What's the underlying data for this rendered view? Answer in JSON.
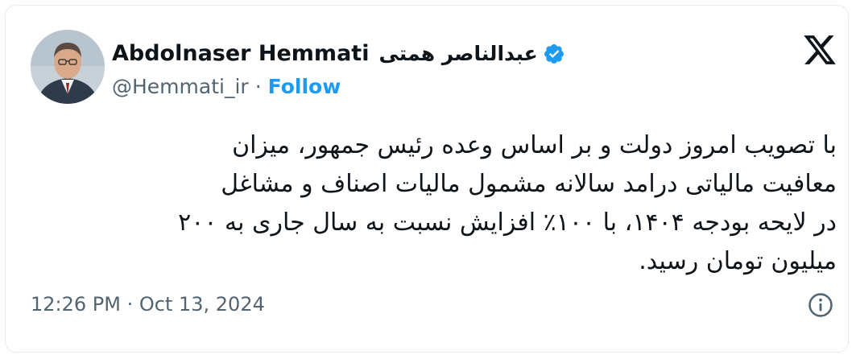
{
  "tweet": {
    "author_name": "Abdolnaser Hemmati",
    "author_name_fa": "عبدالناصر همتی",
    "handle": "@Hemmati_ir",
    "separator": "·",
    "follow_label": "Follow",
    "text_lines": [
      "با تصویب امروز دولت و بر اساس وعده رئیس جمهور، میزان",
      "معافیت مالیاتی درامد سالانه مشمول مالیات اصناف و مشاغل",
      "در لایحه بودجه ۱۴۰۴، با ۱۰۰٪ افزایش نسبت به سال جاری به ۲۰۰",
      "میلیون تومان رسید."
    ],
    "timestamp": "12:26 PM · Oct 13, 2024"
  },
  "icons": {
    "verified": "verified-badge-icon",
    "logo": "x-logo-icon",
    "info": "info-icon"
  },
  "colors": {
    "accent": "#1d9bf0",
    "text": "#0f1419",
    "muted": "#536471",
    "border": "#e6ecf0"
  }
}
